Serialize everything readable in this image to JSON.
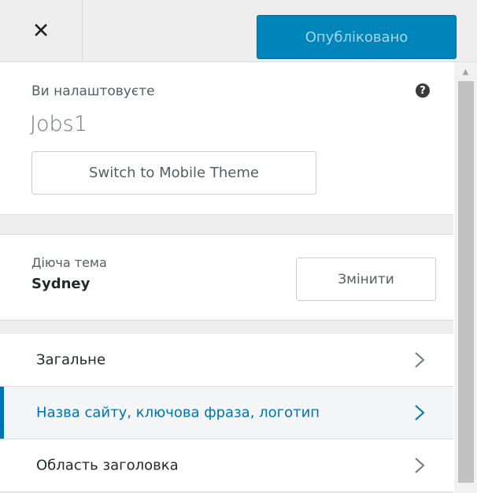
{
  "header": {
    "close_icon": "close-icon",
    "publish_label": "Опубліковано"
  },
  "info": {
    "customizing_label": "Ви налаштовуєте",
    "site_title": "Jobs1",
    "help_icon": "help-icon",
    "help_glyph": "?",
    "mobile_theme_button": "Switch to Mobile Theme"
  },
  "theme": {
    "active_label": "Діюча тема",
    "name": "Sydney",
    "change_button": "Змінити"
  },
  "menu": {
    "items": [
      {
        "label": "Загальне",
        "active": false
      },
      {
        "label": "Назва сайту, ключова фраза, логотип",
        "active": true
      },
      {
        "label": "Область заголовка",
        "active": false
      }
    ]
  },
  "colors": {
    "accent": "#0073aa",
    "publish_bg": "#0085ba",
    "panel_bg": "#eeeeee"
  }
}
